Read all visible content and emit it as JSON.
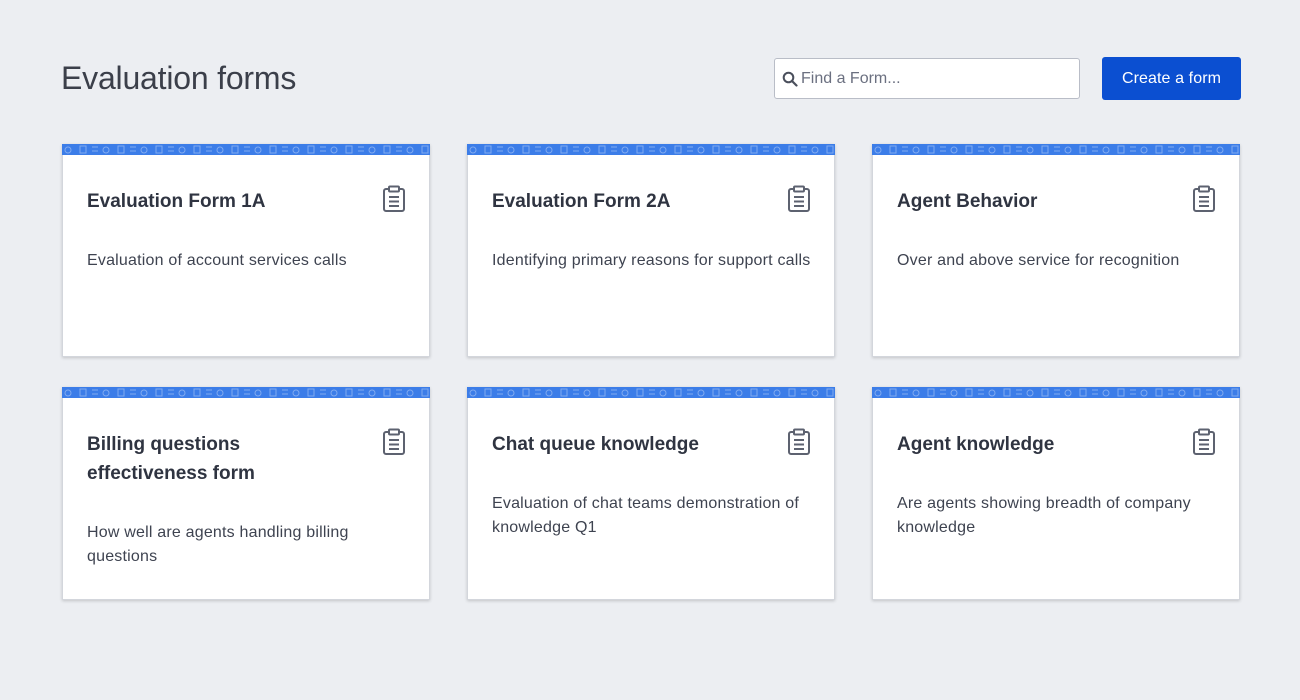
{
  "header": {
    "title": "Evaluation forms",
    "search_placeholder": "Find a Form...",
    "search_value": "",
    "create_label": "Create a form"
  },
  "colors": {
    "background": "#eceef2",
    "accent": "#0b4fd1",
    "card_banner": "#3c7de8"
  },
  "icons": {
    "search": "search-icon",
    "card": "clipboard-icon"
  },
  "cards": [
    {
      "title": "Evaluation Form 1A",
      "description": "Evaluation of account services calls"
    },
    {
      "title": "Evaluation Form 2A",
      "description": "Identifying primary reasons for support calls"
    },
    {
      "title": "Agent Behavior",
      "description": "Over and above service for recognition"
    },
    {
      "title": "Billing questions effectiveness form",
      "description": "How well are agents handling billing questions"
    },
    {
      "title": "Chat queue knowledge",
      "description": "Evaluation of chat teams demonstration of knowledge Q1"
    },
    {
      "title": "Agent knowledge",
      "description": "Are agents showing breadth of company knowledge"
    }
  ]
}
